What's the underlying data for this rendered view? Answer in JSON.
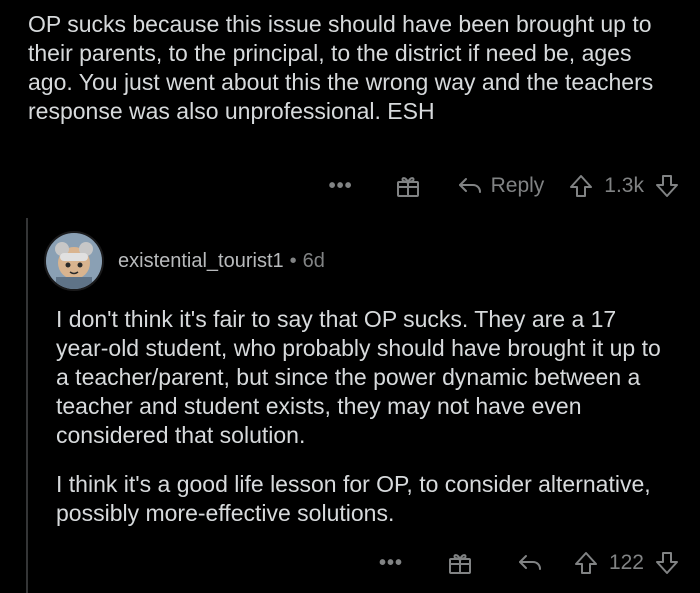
{
  "parent_comment": {
    "body": "OP sucks because this issue should have been brought up to their parents, to the principal, to the district if need be, ages ago. You just went about this the wrong way and the teachers response was also unprofessional. ESH",
    "actions": {
      "more": "•••",
      "award_icon": "gift-icon",
      "reply_label": "Reply",
      "vote_count": "1.3k"
    }
  },
  "reply_comment": {
    "username": "existential_tourist1",
    "separator": "•",
    "age": "6d",
    "paragraphs": [
      "I don't think it's fair to say that OP sucks. They are a 17 year-old student, who probably should have brought it up to a teacher/parent, but since the power dynamic between a teacher and student exists, they may not have even considered that solution.",
      "I think it's a good life lesson for OP, to consider alternative, possibly more-effective solutions."
    ],
    "actions": {
      "more": "•••",
      "award_icon": "gift-icon",
      "vote_count": "122"
    }
  },
  "colors": {
    "background": "#000000",
    "text": "#d7dadc",
    "muted": "#818384",
    "thread_line": "#343536"
  }
}
